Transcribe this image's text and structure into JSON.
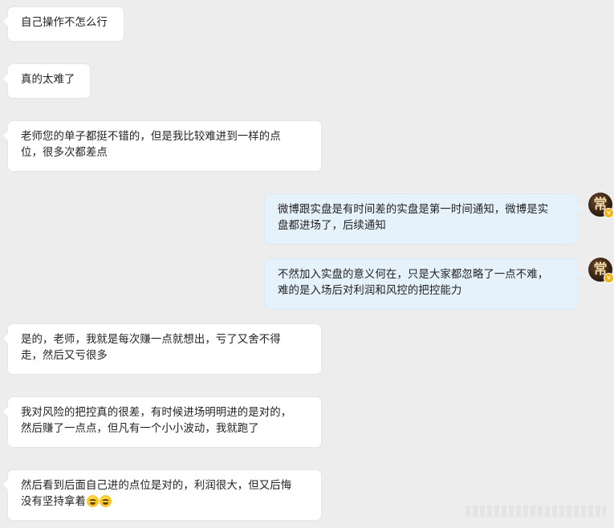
{
  "conversation": {
    "messages": [
      {
        "side": "left",
        "lines": [
          "自己操作不怎么行"
        ]
      },
      {
        "side": "left",
        "lines": [
          "真的太难了"
        ]
      },
      {
        "side": "left",
        "lines": [
          "老师您的单子都挺不错的，但是我比较难进到一样的点",
          "位，很多次都差点"
        ]
      },
      {
        "side": "right",
        "lines": [
          "微博跟实盘是有时间差的实盘是第一时间通知，微博是实",
          "盘都进场了，后续通知"
        ],
        "avatar_char": "常"
      },
      {
        "side": "right",
        "lines": [
          "不然加入实盘的意义何在，只是大家都忽略了一点不难，",
          "难的是入场后对利润和风控的把控能力"
        ],
        "avatar_char": "常"
      },
      {
        "side": "left",
        "lines": [
          "是的，老师，我就是每次赚一点就想出，亏了又舍不得",
          "走，然后又亏很多"
        ]
      },
      {
        "side": "left",
        "lines": [
          "我对风险的把控真的很差，有时候进场明明进的是对的，",
          "然后赚了一点点，但凡有一个小小波动，我就跑了"
        ]
      },
      {
        "side": "left",
        "lines": [
          "然后看到后面自己进的点位是对的，利润很大，但又后悔",
          "没有坚持拿着"
        ],
        "emoji_count": 2,
        "emoji_icon": "laughing-tears-emoji-icon"
      }
    ]
  },
  "colors": {
    "background": "#ededed",
    "bubble_left": "#ffffff",
    "bubble_right": "#e6f2fb",
    "verified_badge": "#f3b21b"
  }
}
